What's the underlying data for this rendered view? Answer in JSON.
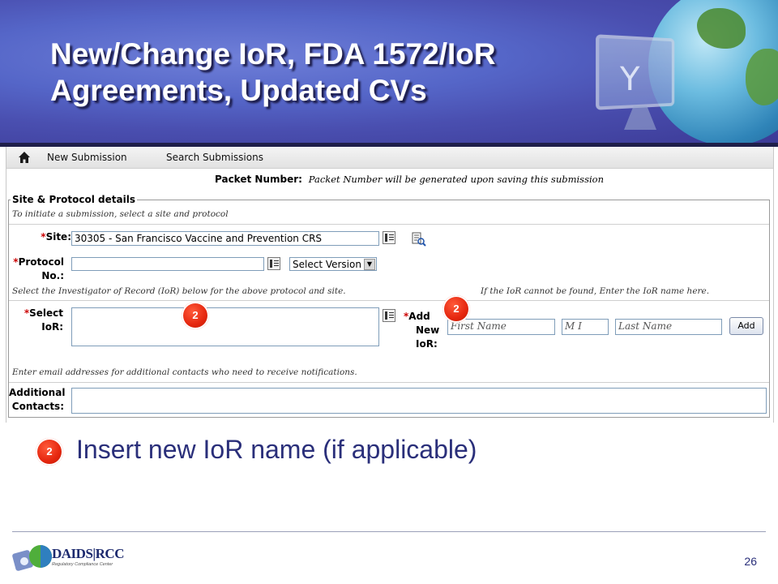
{
  "slide": {
    "title": "New/Change IoR, FDA 1572/IoR\nAgreements, Updated CVs",
    "bullet_badge": "2",
    "bullet_text": "Insert new IoR name (if applicable)",
    "page_number": "26",
    "logo_text": "DAIDS|RCC",
    "logo_subtext": "Regulatory Compliance Center"
  },
  "nav": {
    "items": [
      "New Submission",
      "Search Submissions"
    ]
  },
  "packet": {
    "label": "Packet Number:",
    "note": "Packet Number will be generated upon saving this submission"
  },
  "section": {
    "legend": "Site & Protocol details",
    "intro": "To initiate a submission, select a site and protocol",
    "site_label": "Site:",
    "site_value": "30305 - San Francisco Vaccine and Prevention CRS",
    "protocol_label_1": "Protocol",
    "protocol_label_2": "No.:",
    "protocol_value": "",
    "version_select": "Select Version",
    "ior_note_left": "Select the Investigator of Record (IoR) below for the above protocol and site.",
    "ior_note_right": "If the IoR cannot be found, Enter the IoR name here.",
    "select_ior_label_1": "Select",
    "select_ior_label_2": "IoR:",
    "add_ior_label_1": "Add",
    "add_ior_label_2": "New",
    "add_ior_label_3": "IoR:",
    "first_name_placeholder": "First Name",
    "mi_placeholder": "M I",
    "last_name_placeholder": "Last Name",
    "add_button": "Add",
    "contacts_note": "Enter email addresses for additional contacts who need to receive notifications.",
    "contacts_label_1": "Additional",
    "contacts_label_2": "Contacts:",
    "required_marker": "*"
  },
  "annotations": {
    "badge_left": "2",
    "badge_right": "2"
  },
  "colors": {
    "banner": "#4a4fb0",
    "badge": "#e5260e",
    "bullet_text": "#2a2f7a",
    "required": "#cc0000"
  },
  "icons": [
    "home-icon",
    "lookup-icon",
    "search-icon",
    "globe-icon",
    "monitor-icon"
  ]
}
